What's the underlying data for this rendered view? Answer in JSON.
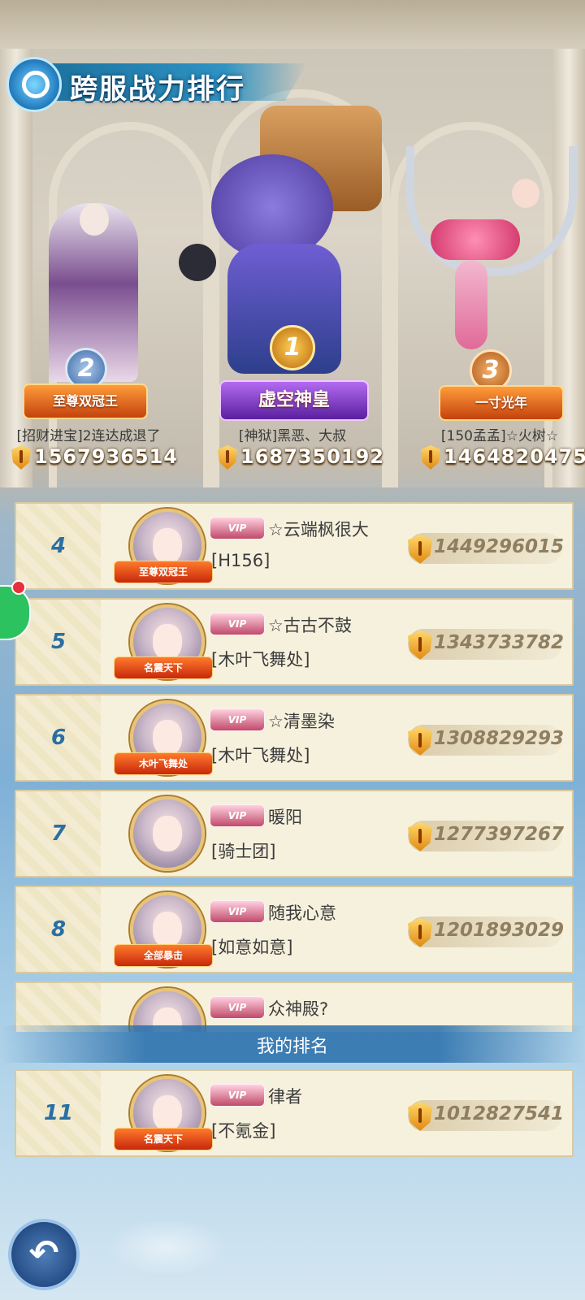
{
  "header": {
    "title": "跨服战力排行"
  },
  "podium": [
    {
      "rank": "2",
      "badge": "至尊双冠王",
      "name": "[招财进宝]2连达成退了",
      "power": "1567936514",
      "badge_color": "#d9731b"
    },
    {
      "rank": "1",
      "badge": "虚空神皇",
      "name": "[神狱]黑恶、大叔",
      "power": "1687350192",
      "badge_color": "#8a3fd1"
    },
    {
      "rank": "3",
      "badge": "一寸光年",
      "name": "[150孟孟]☆火树☆",
      "power": "1464820475",
      "badge_color": "#d9731b"
    }
  ],
  "list": [
    {
      "rank": "4",
      "name": "☆云端枫很大",
      "guild": "[H156]",
      "power": "1449296015",
      "avatar_badge": "至尊双冠王"
    },
    {
      "rank": "5",
      "name": "☆古古不鼓",
      "guild": "[木叶飞舞处]",
      "power": "1343733782",
      "avatar_badge": "名震天下"
    },
    {
      "rank": "6",
      "name": "☆清墨染",
      "guild": "[木叶飞舞处]",
      "power": "1308829293",
      "avatar_badge": "木叶飞舞处"
    },
    {
      "rank": "7",
      "name": "暖阳",
      "guild": "[骑士团]",
      "power": "1277397267",
      "avatar_badge": ""
    },
    {
      "rank": "8",
      "name": "随我心意",
      "guild": "[如意如意]",
      "power": "1201893029",
      "avatar_badge": "全部暴击"
    },
    {
      "rank": "",
      "name": "众神殿?",
      "guild": "",
      "power": "",
      "avatar_badge": ""
    }
  ],
  "mine": {
    "header": "我的排名",
    "rank": "11",
    "name": "律者",
    "guild": "[不氪金]",
    "power": "1012827541",
    "avatar_badge": "名震天下"
  },
  "icons": {
    "back": "back-arrow-icon",
    "power": "power-shield-icon"
  },
  "colors": {
    "accent": "#2a6fa3",
    "power_text": "#8f7f60"
  }
}
